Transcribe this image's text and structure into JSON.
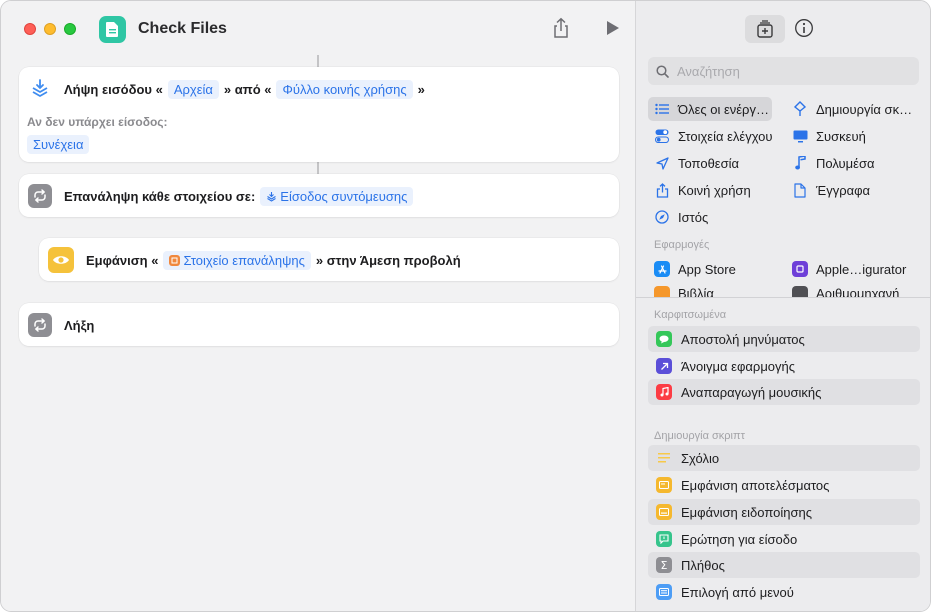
{
  "window": {
    "title": "Check Files"
  },
  "colors": {
    "accent": "#2b73e8",
    "app_icon": "#2fc6a4",
    "pill_bg": "#eaf1fd"
  },
  "editor": {
    "actions": [
      {
        "icon": "download-input-icon",
        "prefix": "Λήψη εισόδου «",
        "param1": "Αρχεία",
        "middle": "» από «",
        "param2": "Φύλλο κοινής χρήσης",
        "suffix": "»",
        "no_input_label": "Αν δεν υπάρχει είσοδος:",
        "no_input_value": "Συνέχεια"
      },
      {
        "icon": "repeat-icon",
        "prefix": "Επανάληψη κάθε στοιχείου σε:",
        "param1": "Είσοδος συντόμευσης"
      },
      {
        "icon": "eye-icon",
        "prefix": "Εμφάνιση «",
        "param1": "Στοιχείο επανάληψης",
        "suffix": "» στην Άμεση προβολή"
      },
      {
        "icon": "repeat-icon",
        "prefix": "Λήξη"
      }
    ]
  },
  "sidebar": {
    "search_placeholder": "Αναζήτηση",
    "categories": [
      {
        "label": "Όλες οι ενέργ…",
        "icon": "list-icon",
        "selected": true
      },
      {
        "label": "Δημιουργία σκ…",
        "icon": "script-icon"
      },
      {
        "label": "Στοιχεία ελέγχου",
        "icon": "toggle-icon"
      },
      {
        "label": "Συσκευή",
        "icon": "display-icon"
      },
      {
        "label": "Τοποθεσία",
        "icon": "location-arrow-icon"
      },
      {
        "label": "Πολυμέσα",
        "icon": "music-note-icon"
      },
      {
        "label": "Κοινή χρήση",
        "icon": "share-icon"
      },
      {
        "label": "Έγγραφα",
        "icon": "document-icon"
      },
      {
        "label": "Ιστός",
        "icon": "compass-icon"
      }
    ],
    "apps_section_label": "Εφαρμογές",
    "apps": [
      {
        "label": "App Store",
        "icon": "app-store-icon"
      },
      {
        "label": "Apple…igurator",
        "icon": "apple-configurator-icon"
      },
      {
        "label": "Βιβλία",
        "icon": "books-icon"
      },
      {
        "label": "Αριθμομηχανή",
        "icon": "calculator-icon"
      }
    ],
    "pinned_section_label": "Καρφιτσωμένα",
    "pinned": [
      {
        "label": "Αποστολή μηνύματος",
        "icon": "messages-icon",
        "color": "#34c759"
      },
      {
        "label": "Άνοιγμα εφαρμογής",
        "icon": "open-app-icon",
        "color": "#5b4fd8"
      },
      {
        "label": "Αναπαραγωγή μουσικής",
        "icon": "music-icon",
        "color": "#fc3c44"
      }
    ],
    "scripting_section_label": "Δημιουργία σκριπτ",
    "scripting": [
      {
        "label": "Σχόλιο",
        "icon": "comment-lines-icon",
        "color": "#f7c948"
      },
      {
        "label": "Εμφάνιση αποτελέσματος",
        "icon": "show-result-icon",
        "color": "#f5b82e"
      },
      {
        "label": "Εμφάνιση ειδοποίησης",
        "icon": "alert-icon",
        "color": "#f5b82e"
      },
      {
        "label": "Ερώτηση για είσοδο",
        "icon": "ask-input-icon",
        "color": "#36c48c"
      },
      {
        "label": "Πλήθος",
        "icon": "sigma-icon",
        "color": "#8e8e93"
      },
      {
        "label": "Επιλογή από μενού",
        "icon": "menu-icon",
        "color": "#4d9df5"
      }
    ]
  }
}
